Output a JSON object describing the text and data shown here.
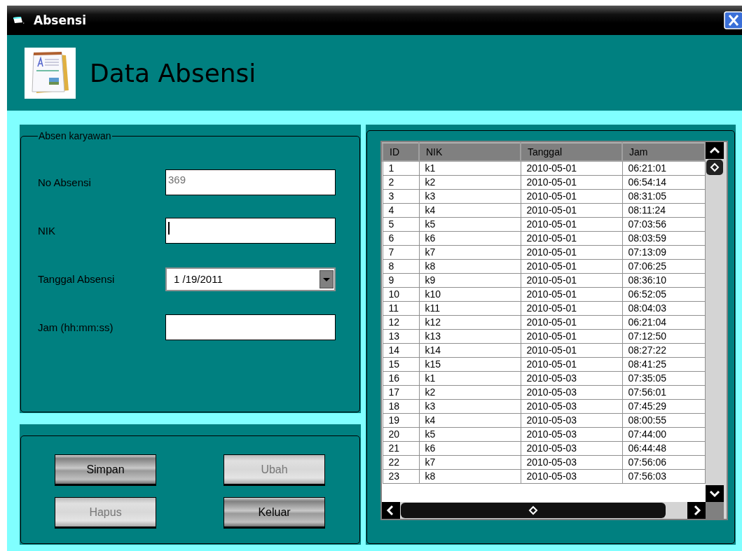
{
  "window": {
    "title": "Absensi"
  },
  "header": {
    "title": "Data Absensi"
  },
  "form": {
    "legend": "Absen karyawan",
    "fields": [
      {
        "label": "No Absensi",
        "kind": "text",
        "value": "369",
        "disabled": true,
        "focused": false
      },
      {
        "label": "NIK",
        "kind": "text",
        "focused": true
      },
      {
        "label": "Tanggal Absensi",
        "kind": "date",
        "value": "1 /19/2011",
        "disabled": false,
        "focused": false
      },
      {
        "label": "Jam (hh:mm:ss)",
        "kind": "text",
        "focused": false
      }
    ]
  },
  "buttons": [
    {
      "label": "Simpan",
      "disabled": false
    },
    {
      "label": "Ubah",
      "disabled": true
    },
    {
      "label": "Hapus",
      "disabled": true
    },
    {
      "label": "Keluar",
      "disabled": false
    }
  ],
  "table": {
    "columns": [
      "ID",
      "NIK",
      "Tanggal",
      "Jam"
    ],
    "rows": [
      [
        "1",
        "k1",
        "2010-05-01",
        "06:21:01"
      ],
      [
        "2",
        "k2",
        "2010-05-01",
        "06:54:14"
      ],
      [
        "3",
        "k3",
        "2010-05-01",
        "08:31:05"
      ],
      [
        "4",
        "k4",
        "2010-05-01",
        "08:11:24"
      ],
      [
        "5",
        "k5",
        "2010-05-01",
        "07:03:56"
      ],
      [
        "6",
        "k6",
        "2010-05-01",
        "08:03:59"
      ],
      [
        "7",
        "k7",
        "2010-05-01",
        "07:13:09"
      ],
      [
        "8",
        "k8",
        "2010-05-01",
        "07:06:25"
      ],
      [
        "9",
        "k9",
        "2010-05-01",
        "08:36:10"
      ],
      [
        "10",
        "k10",
        "2010-05-01",
        "06:52:05"
      ],
      [
        "11",
        "k11",
        "2010-05-01",
        "08:04:03"
      ],
      [
        "12",
        "k12",
        "2010-05-01",
        "06:21:04"
      ],
      [
        "13",
        "k13",
        "2010-05-01",
        "07:12:50"
      ],
      [
        "14",
        "k14",
        "2010-05-01",
        "08:27:22"
      ],
      [
        "15",
        "k15",
        "2010-05-01",
        "08:41:25"
      ],
      [
        "16",
        "k1",
        "2010-05-03",
        "07:35:05"
      ],
      [
        "17",
        "k2",
        "2010-05-03",
        "07:56:01"
      ],
      [
        "18",
        "k3",
        "2010-05-03",
        "07:45:29"
      ],
      [
        "19",
        "k4",
        "2010-05-03",
        "08:00:55"
      ],
      [
        "20",
        "k5",
        "2010-05-03",
        "07:44:00"
      ],
      [
        "21",
        "k6",
        "2010-05-03",
        "06:44:48"
      ],
      [
        "22",
        "k7",
        "2010-05-03",
        "07:56:06"
      ],
      [
        "23",
        "k8",
        "2010-05-03",
        "07:56:03"
      ]
    ]
  }
}
